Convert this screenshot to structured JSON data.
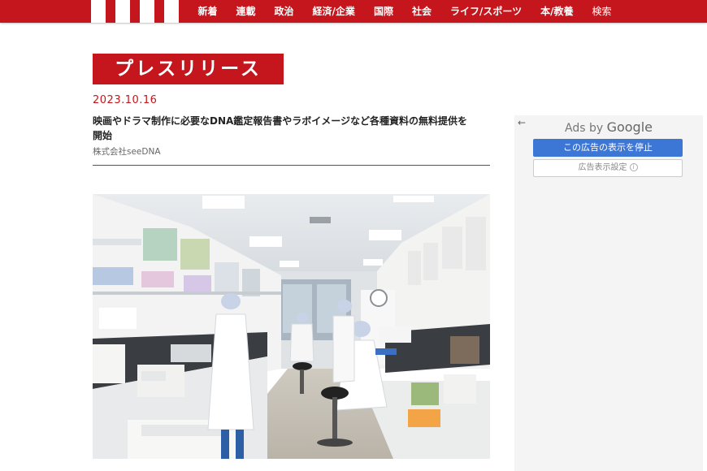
{
  "nav": {
    "items": [
      "新着",
      "連載",
      "政治",
      "経済/企業",
      "国際",
      "社会",
      "ライフ/スポーツ",
      "本/教養",
      "検索"
    ]
  },
  "colors": {
    "brand": "#c4161c",
    "ad_button": "#3d77d6"
  },
  "article": {
    "category_label": "プレスリリース",
    "date": "2023.10.16",
    "headline_line1": "映画やドラマ制作に必要なDNA鑑定報告書やラボイメージなど各種資料の無料提供を",
    "headline_line2": "開始",
    "company": "株式会社seeDNA"
  },
  "ad": {
    "back_icon": "←",
    "ads_by": "Ads by",
    "google": "Google",
    "stop_label": "この広告の表示を停止",
    "why_label": "広告表示設定",
    "info_icon": "i"
  }
}
